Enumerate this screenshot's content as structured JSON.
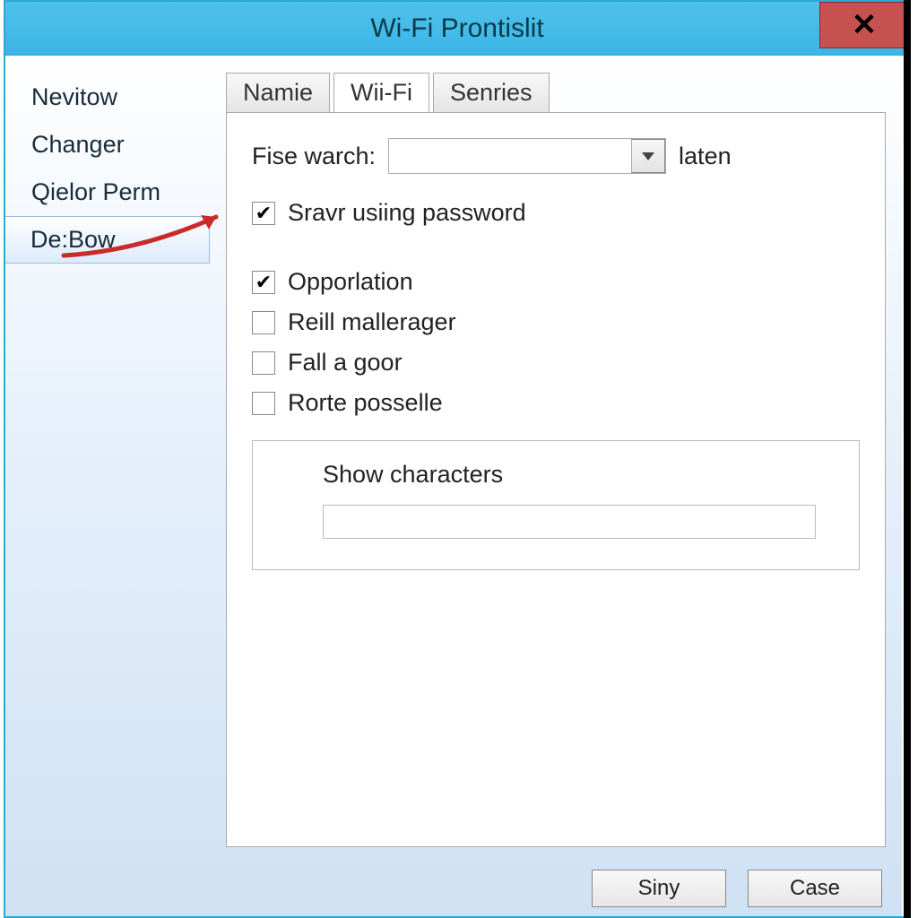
{
  "window": {
    "title": "Wi-Fi Prontislit"
  },
  "sidebar": {
    "items": [
      {
        "label": "Nevitow"
      },
      {
        "label": "Changer"
      },
      {
        "label": "Qielor Perm"
      },
      {
        "label": "De:Bow"
      }
    ],
    "selected_index": 3
  },
  "tabs": [
    {
      "label": "Namie"
    },
    {
      "label": "Wii-Fi"
    },
    {
      "label": "Senries"
    }
  ],
  "active_tab_index": 1,
  "form": {
    "fise_label": "Fise warch:",
    "fise_value": "",
    "fise_unit": "laten",
    "checks": [
      {
        "label": "Sravr usiing password",
        "checked": true
      },
      {
        "label": "Opporlation",
        "checked": true
      },
      {
        "label": "Reill mallerager",
        "checked": false
      },
      {
        "label": "Fall a goor",
        "checked": false
      },
      {
        "label": "Rorte posselle",
        "checked": false
      }
    ],
    "group_label": "Show characters",
    "group_value": ""
  },
  "buttons": {
    "ok": "Siny",
    "cancel": "Case"
  },
  "annotation": {
    "arrow_color": "#c92a2a"
  }
}
